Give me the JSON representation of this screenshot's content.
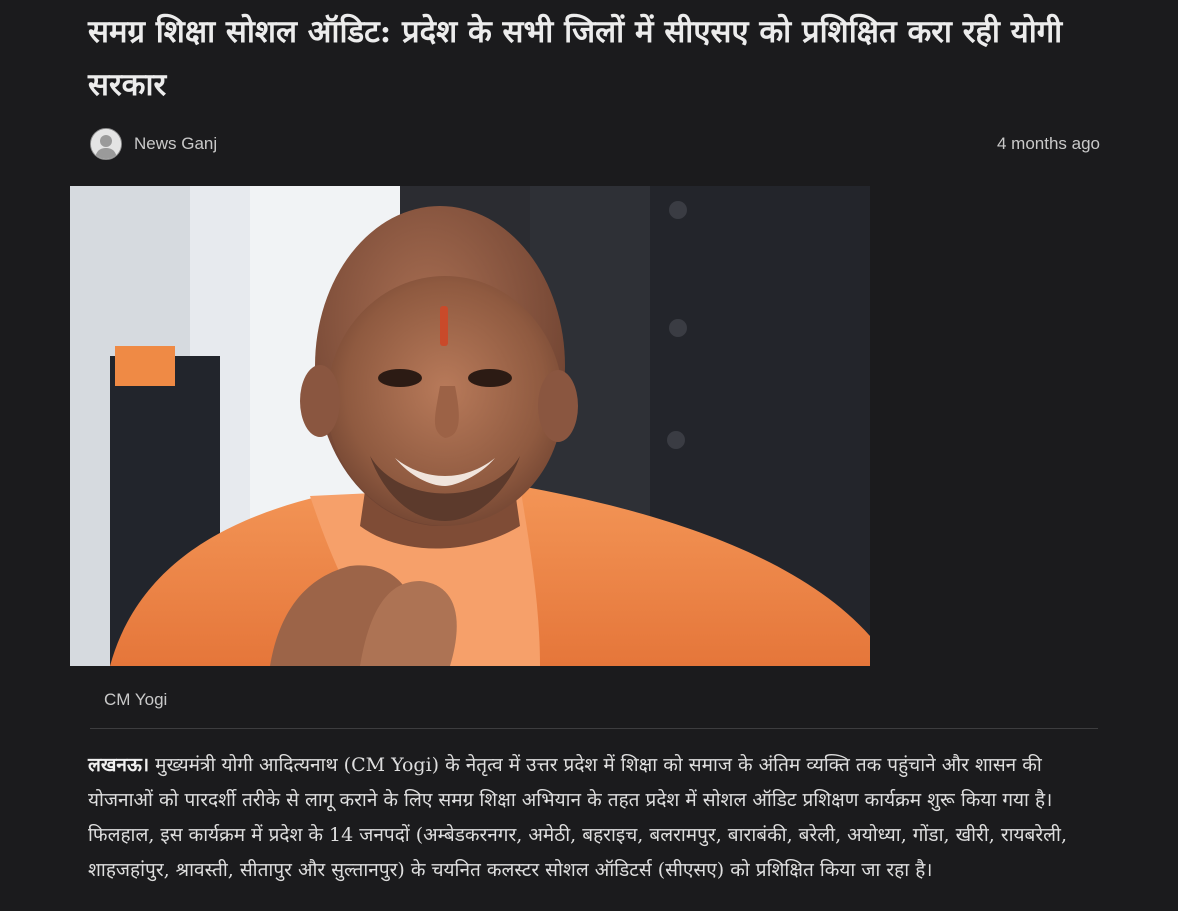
{
  "article": {
    "title": "समग्र शिक्षा सोशल ऑडिट: प्रदेश के सभी जिलों में सीएसए को प्रशिक्षित करा रही योगी सरकार",
    "author": "News Ganj",
    "time": "4 months ago",
    "image_caption": "CM Yogi",
    "dateline": "लखनऊ।",
    "body": "मुख्यमंत्री योगी आदित्यनाथ (CM Yogi) के नेतृत्व में उत्तर प्रदेश में शिक्षा को समाज के अंतिम व्यक्ति तक पहुंचाने और शासन की योजनाओं को पारदर्शी तरीके से लागू कराने के लिए समग्र शिक्षा अभियान के तहत प्रदेश में सोशल ऑडिट प्रशिक्षण कार्यक्रम शुरू किया गया है। फिलहाल, इस कार्यक्रम में प्रदेश के 14 जनपदों (अम्बेडकरनगर, अमेठी, बहराइच, बलरामपुर, बाराबंकी, बरेली, अयोध्या, गोंडा, खीरी, रायबरेली, शाहजहांपुर, श्रावस्ती, सीतापुर और सुल्तानपुर) के चयनित कलस्टर सोशल ऑडिटर्स (सीएसए) को प्रशिक्षित किया जा रहा है।"
  },
  "colors": {
    "background": "#1b1b1d",
    "text": "#e6e6e6",
    "saffron": "#f08a4b"
  },
  "icons": {
    "avatar": "user-avatar-icon"
  }
}
